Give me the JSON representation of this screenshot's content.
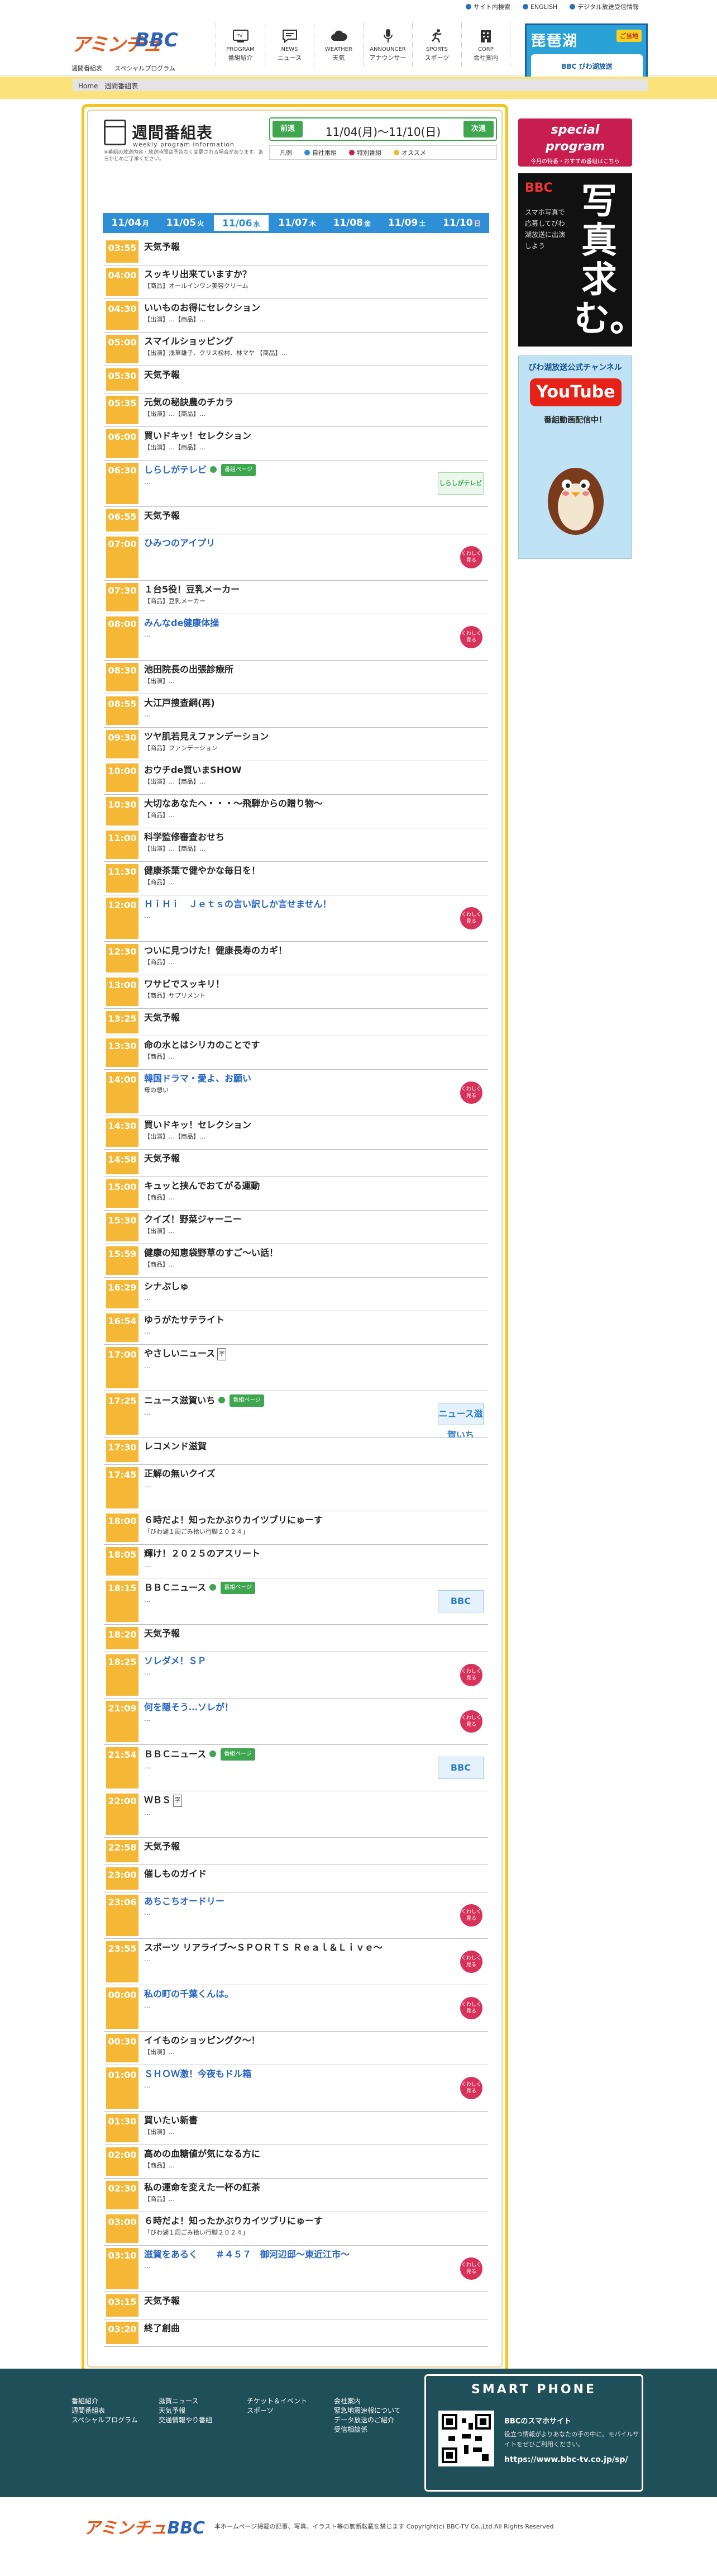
{
  "top_links": [
    "サイト内検索",
    "ENGLISH",
    "デジタル放送受信情報"
  ],
  "logo": {
    "part1": "アミンチュ",
    "part2": "BBC"
  },
  "sub_nav": [
    "週間番組表",
    "スペシャルプログラム"
  ],
  "global_nav": [
    {
      "jp": "番組紹介",
      "en": "PROGRAM",
      "icon": "tv-icon"
    },
    {
      "jp": "ニュース",
      "en": "NEWS",
      "icon": "news-icon"
    },
    {
      "jp": "天気",
      "en": "WEATHER",
      "icon": "weather-icon"
    },
    {
      "jp": "アナウンサー",
      "en": "ANNOUNCER",
      "icon": "microphone-icon"
    },
    {
      "jp": "スポーツ",
      "en": "SPORTS",
      "icon": "sports-icon"
    },
    {
      "jp": "会社案内",
      "en": "CORP",
      "icon": "building-icon"
    }
  ],
  "top_banner": {
    "title": "琵琶湖",
    "badge": "ご当地",
    "sub": "BBC びわ湖放送"
  },
  "breadcrumb": [
    "Home",
    "週間番組表"
  ],
  "page_title": {
    "jp": "週間番組表",
    "en": "weekly program information",
    "note": "※番組の放送内容・放送時間は予告なく変更される場合があります。あらかじめご了承ください。"
  },
  "week_nav": {
    "prev": "前週",
    "next": "次週",
    "range": "11/04(月)〜11/10(日)"
  },
  "legend": [
    "凡例",
    "自社番組",
    "特別番組",
    "オススメ"
  ],
  "legend_colors": [
    "#2e8fd6",
    "#c81e4f",
    "#f5b836"
  ],
  "days": [
    {
      "date": "11/04",
      "dow": "月"
    },
    {
      "date": "11/05",
      "dow": "火"
    },
    {
      "date": "11/06",
      "dow": "水"
    },
    {
      "date": "11/07",
      "dow": "木"
    },
    {
      "date": "11/08",
      "dow": "金"
    },
    {
      "date": "11/09",
      "dow": "土"
    },
    {
      "date": "11/10",
      "dow": "日"
    }
  ],
  "current_day_index": 2,
  "programs": [
    {
      "time": "03:55",
      "title": "天気予報",
      "desc": "",
      "h": 34
    },
    {
      "time": "04:00",
      "title": "スッキリ出来ていますか？",
      "desc": "【商品】オールインワン美容クリーム",
      "h": 42
    },
    {
      "time": "04:30",
      "title": "いいものお得にセレクション",
      "desc": "【出演】…【商品】…",
      "h": 42
    },
    {
      "time": "05:00",
      "title": "スマイルショッピング",
      "desc": "【出演】浅草雄子、クリス松村、林マヤ 【商品】…",
      "h": 42
    },
    {
      "time": "05:30",
      "title": "天気予報",
      "desc": "",
      "h": 34
    },
    {
      "time": "05:35",
      "title": "元気の秘訣農のチカラ",
      "desc": "【出演】…【商品】…",
      "h": 42
    },
    {
      "time": "06:00",
      "title": "買いドキッ！セレクション",
      "desc": "【出演】…【商品】…",
      "h": 42
    },
    {
      "time": "06:30",
      "title": "しらしがテレビ",
      "desc": "…",
      "h": 58,
      "blue": true,
      "tag": "番組ページ",
      "thumb": "しらしがテレビ",
      "thumb_green": true
    },
    {
      "time": "06:55",
      "title": "天気予報",
      "desc": "",
      "h": 34
    },
    {
      "time": "07:00",
      "title": "ひみつのアイプリ",
      "desc": "",
      "h": 58,
      "blue": true,
      "more": true
    },
    {
      "time": "07:30",
      "title": "１台5役！豆乳メーカー",
      "desc": "【商品】豆乳メーカー",
      "h": 42
    },
    {
      "time": "08:00",
      "title": "みんなde健康体操",
      "desc": "…",
      "h": 58,
      "blue": true,
      "more": true
    },
    {
      "time": "08:30",
      "title": "池田院長の出張診療所",
      "desc": "【出演】…",
      "h": 42
    },
    {
      "time": "08:55",
      "title": "大江戸捜査網(再)",
      "desc": "…",
      "h": 42
    },
    {
      "time": "09:30",
      "title": "ツヤ肌若見えファンデーション",
      "desc": "【商品】ファンデーション",
      "h": 42
    },
    {
      "time": "10:00",
      "title": "おウチde買いまSHOW",
      "desc": "【出演】…【商品】…",
      "h": 42
    },
    {
      "time": "10:30",
      "title": "大切なあなたへ・・・〜飛騨からの贈り物〜",
      "desc": "【商品】…",
      "h": 42
    },
    {
      "time": "11:00",
      "title": "科学監修審査おせち",
      "desc": "【出演】…【商品】…",
      "h": 42
    },
    {
      "time": "11:30",
      "title": "健康茶葉で健やかな毎日を！",
      "desc": "【商品】…",
      "h": 42
    },
    {
      "time": "12:00",
      "title": "ＨｉＨｉ　Ｊｅｔｓの言い訳しか言せません！",
      "desc": "…",
      "h": 58,
      "blue": true,
      "more": true
    },
    {
      "time": "12:30",
      "title": "ついに見つけた！健康長寿のカギ！",
      "desc": "【商品】…",
      "h": 42
    },
    {
      "time": "13:00",
      "title": "ワサビでスッキリ！",
      "desc": "【商品】サプリメント",
      "h": 42
    },
    {
      "time": "13:25",
      "title": "天気予報",
      "desc": "",
      "h": 34
    },
    {
      "time": "13:30",
      "title": "命の水とはシリカのことです",
      "desc": "【商品】…",
      "h": 42
    },
    {
      "time": "14:00",
      "title": "韓国ドラマ・愛よ、お願い",
      "desc": "母の想い",
      "h": 58,
      "blue": true,
      "more": true
    },
    {
      "time": "14:30",
      "title": "買いドキッ！セレクション",
      "desc": "【出演】…【商品】…",
      "h": 42
    },
    {
      "time": "14:58",
      "title": "天気予報",
      "desc": "",
      "h": 34
    },
    {
      "time": "15:00",
      "title": "キュッと挟んでおてがる運動",
      "desc": "【商品】…",
      "h": 42
    },
    {
      "time": "15:30",
      "title": "クイズ！野菜ジャーニー",
      "desc": "【出演】…",
      "h": 42
    },
    {
      "time": "15:59",
      "title": "健康の知恵袋野草のすご〜い話！",
      "desc": "【商品】…",
      "h": 42
    },
    {
      "time": "16:29",
      "title": "シナぷしゅ",
      "desc": "…",
      "h": 42
    },
    {
      "time": "16:54",
      "title": "ゆうがたサテライト",
      "desc": "…",
      "h": 42
    },
    {
      "time": "17:00",
      "title": "やさしいニュース",
      "desc": "…",
      "h": 58,
      "sq": true
    },
    {
      "time": "17:25",
      "title": "ニュース滋賀いち",
      "desc": "…",
      "h": 58,
      "tag": "番組ページ",
      "thumb": "ニュース滋賀いち"
    },
    {
      "time": "17:30",
      "title": "レコメンド滋賀",
      "desc": "",
      "h": 34
    },
    {
      "time": "17:45",
      "title": "正解の無いクイズ",
      "desc": "…",
      "h": 58
    },
    {
      "time": "18:00",
      "title": "６時だよ！知ったかぶりカイツブリにゅーす",
      "desc": "「びわ湖１周ごみ拾い行脚２０２４」",
      "h": 42
    },
    {
      "time": "18:05",
      "title": "輝け！２０２５のアスリート",
      "desc": "…",
      "h": 42
    },
    {
      "time": "18:15",
      "title": "ＢＢＣニュース",
      "desc": "…",
      "h": 58,
      "tag": "番組ページ",
      "thumb": "BBC"
    },
    {
      "time": "18:20",
      "title": "天気予報",
      "desc": "",
      "h": 34
    },
    {
      "time": "18:25",
      "title": "ソレダメ！ＳＰ",
      "desc": "…",
      "h": 58,
      "blue": true,
      "more": true
    },
    {
      "time": "21:09",
      "title": "何を隠そう…ソレが！",
      "desc": "…",
      "h": 58,
      "blue": true,
      "more": true
    },
    {
      "time": "21:54",
      "title": "ＢＢＣニュース",
      "desc": "…",
      "h": 58,
      "tag": "番組ページ",
      "thumb": "BBC"
    },
    {
      "time": "22:00",
      "title": "ＷＢＳ",
      "desc": "…",
      "h": 58,
      "sq": true
    },
    {
      "time": "22:58",
      "title": "天気予報",
      "desc": "",
      "h": 34
    },
    {
      "time": "23:00",
      "title": "催しものガイド",
      "desc": "",
      "h": 34
    },
    {
      "time": "23:06",
      "title": "あちこちオードリー",
      "desc": "…",
      "h": 58,
      "blue": true,
      "more": true
    },
    {
      "time": "23:55",
      "title": "スポーツ リアライブ〜ＳＰＯＲＴＳ Ｒｅａｌ＆Ｌｉｖｅ〜",
      "desc": "…",
      "h": 58,
      "more": true
    },
    {
      "time": "00:00",
      "title": "私の町の千葉くんは。",
      "desc": "…",
      "h": 58,
      "blue": true,
      "more": true
    },
    {
      "time": "00:30",
      "title": "イイものショッピングク〜！",
      "desc": "【出演】…",
      "h": 42
    },
    {
      "time": "01:00",
      "title": "ＳＨＯＷ激！今夜もドル箱",
      "desc": "…",
      "h": 58,
      "blue": true,
      "more": true
    },
    {
      "time": "01:30",
      "title": "買いたい新書",
      "desc": "【出演】…",
      "h": 42
    },
    {
      "time": "02:00",
      "title": "高めの血糖値が気になる方に",
      "desc": "【商品】…",
      "h": 42
    },
    {
      "time": "02:30",
      "title": "私の運命を変えた一杯の紅茶",
      "desc": "【商品】…",
      "h": 42
    },
    {
      "time": "03:00",
      "title": "６時だよ！知ったかぶりカイツブリにゅーす",
      "desc": "「びわ湖１周ごみ拾い行脚２０２４」",
      "h": 42
    },
    {
      "time": "03:10",
      "title": "滋賀をあるく　　＃４５７　御河辺邸〜東近江市〜",
      "desc": "…",
      "h": 58,
      "blue": true,
      "more": true
    },
    {
      "time": "03:15",
      "title": "天気予報",
      "desc": "",
      "h": 34
    },
    {
      "time": "03:20",
      "title": "終了創曲",
      "desc": "",
      "h": 34
    }
  ],
  "more_label": "くわしく見る",
  "side_banners": {
    "special": {
      "l1": "special",
      "l2": "program",
      "l3": "今月の特番・おすすめ番組はこちら"
    },
    "photo": {
      "brand": "BBC",
      "big": "写真求む。",
      "text": "スマホ写真で応募してびわ湖放送に出演しよう"
    },
    "youtube": {
      "head": "びわ湖放送公式チャンネル",
      "yt": "YouTube",
      "sub": "番組動画配信中！"
    }
  },
  "footer": {
    "col1": [
      "番組紹介",
      "週間番組表",
      "スペシャルプログラム"
    ],
    "col2": [
      "滋賀ニュース",
      "天気予報",
      "交通情報やり番組"
    ],
    "col3": [
      "チケット＆イベント",
      "スポーツ"
    ],
    "col4": [
      "会社案内",
      "緊急地震速報について",
      "データ放送のご紹介",
      "受信相談係"
    ],
    "smartphone": {
      "title": "SMART PHONE",
      "site": "BBCのスマホサイト",
      "text": "役立つ情報がよりあなたの手の中に。モバイルサイトをぜひご利用ください。",
      "url": "https://www.bbc-tv.co.jp/sp/"
    }
  },
  "bottom": {
    "logo": "アミンチュBBC",
    "copyright": "本ホームページ掲載の記事、写真、イラスト等の無断転載を禁じます Copyright(c) BBC-TV Co.,Ltd All Rights Reserved"
  }
}
